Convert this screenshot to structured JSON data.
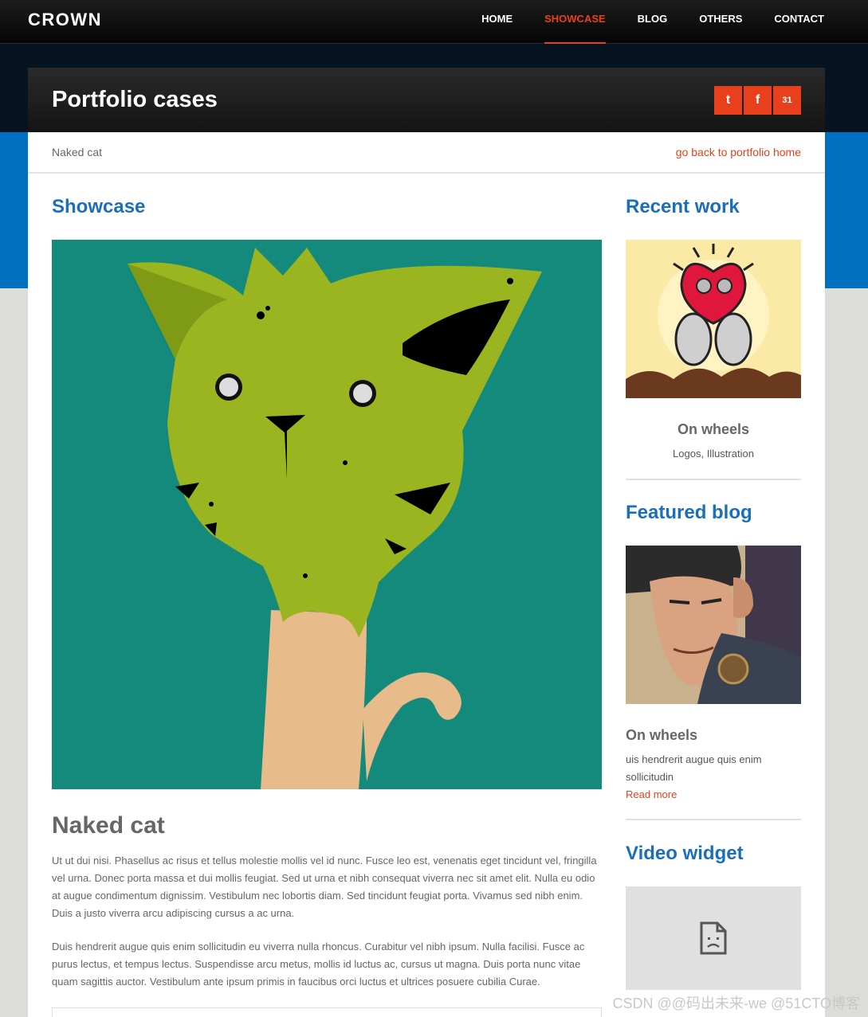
{
  "brand": "CROWN",
  "nav": [
    {
      "label": "HOME",
      "active": false
    },
    {
      "label": "SHOWCASE",
      "active": true
    },
    {
      "label": "BLOG",
      "active": false
    },
    {
      "label": "OTHERS",
      "active": false
    },
    {
      "label": "CONTACT",
      "active": false
    }
  ],
  "header": {
    "title": "Portfolio cases",
    "social": [
      {
        "icon": "twitter-icon",
        "glyph": "t"
      },
      {
        "icon": "facebook-icon",
        "glyph": "f"
      },
      {
        "icon": "calendar-icon",
        "glyph": "31"
      }
    ]
  },
  "breadcrumb": {
    "current": "Naked cat",
    "back_link": "go back to portfolio home"
  },
  "main": {
    "section_title": "Showcase",
    "article_title": "Naked cat",
    "paragraphs": [
      "Ut ut dui nisi. Phasellus ac risus et tellus molestie mollis vel id nunc. Fusce leo est, venenatis eget tincidunt vel, fringilla vel urna. Donec porta massa et dui mollis feugiat. Sed ut urna et nibh consequat viverra nec sit amet elit. Nulla eu odio at augue condimentum dignissim. Vestibulum nec lobortis diam. Sed tincidunt feugiat porta. Vivamus sed nibh enim. Duis a justo viverra arcu adipiscing cursus a ac urna.",
      "Duis hendrerit augue quis enim sollicitudin eu viverra nulla rhoncus. Curabitur vel nibh ipsum. Nulla facilisi. Fusce ac purus lectus, et tempus lectus. Suspendisse arcu metus, mollis id luctus ac, cursus ut magna. Duis porta nunc vitae quam sagittis auctor. Vestibulum ante ipsum primis in faucibus orci luctus et ultrices posuere cubilia Curae."
    ]
  },
  "sidebar": {
    "recent_work": {
      "heading": "Recent work",
      "title": "On wheels",
      "tags": "Logos, Illustration"
    },
    "featured_blog": {
      "heading": "Featured blog",
      "title": "On wheels",
      "excerpt": "uis hendrerit augue quis enim sollicitudin",
      "read_more": "Read more"
    },
    "video": {
      "heading": "Video widget"
    }
  },
  "watermark": "CSDN @@码出未来-we @51CTO博客",
  "colors": {
    "accent": "#e8401c",
    "brand_blue": "#1a6fb8",
    "band_blue": "#006fc0"
  }
}
